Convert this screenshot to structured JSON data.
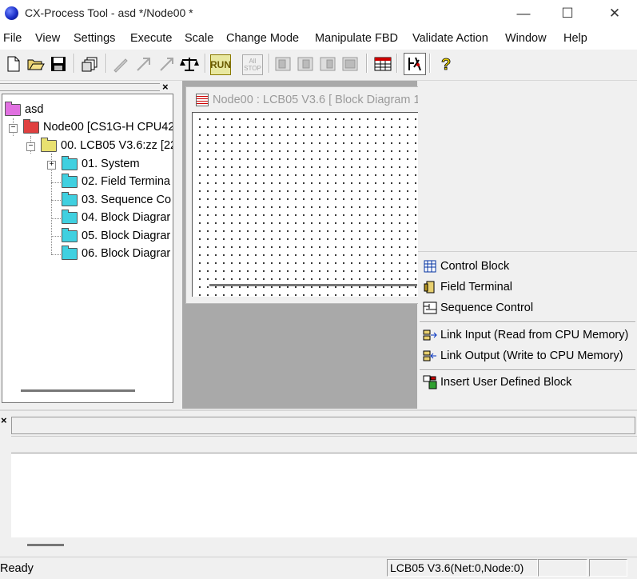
{
  "window": {
    "title": "CX-Process Tool - asd */Node00 *",
    "minimize_glyph": "—",
    "maximize_glyph": "☐",
    "close_glyph": "✕"
  },
  "menu": [
    "File",
    "View",
    "Settings",
    "Execute",
    "Scale",
    "Change Mode",
    "Manipulate FBD",
    "Validate Action",
    "Window",
    "Help"
  ],
  "toolbar": {
    "buttons": [
      {
        "name": "new-icon"
      },
      {
        "name": "open-icon"
      },
      {
        "name": "save-icon"
      },
      {
        "name": "copy-windows-icon"
      },
      {
        "name": "pen-icon"
      },
      {
        "name": "arrow-diagonal-icon"
      },
      {
        "name": "arrow-diagonal-2-icon"
      },
      {
        "name": "balance-icon"
      },
      {
        "name": "run-icon",
        "label": "RUN"
      },
      {
        "name": "all-stop-icon",
        "label": "All STOP"
      },
      {
        "name": "block-1-icon"
      },
      {
        "name": "block-2-icon"
      },
      {
        "name": "block-3-icon"
      },
      {
        "name": "block-4-icon"
      },
      {
        "name": "table-icon"
      },
      {
        "name": "tools-icon"
      },
      {
        "name": "help-icon"
      }
    ]
  },
  "tree": {
    "close_glyph": "×",
    "items": [
      {
        "label": "asd",
        "color": "#e070e0"
      },
      {
        "label": "Node00 [CS1G-H CPU42",
        "color": "#e04040"
      },
      {
        "label": "00. LCB05 V3.6:zz [22",
        "color": "#e8e070"
      },
      {
        "label": "01. System",
        "color": "#40d0e0"
      },
      {
        "label": "02. Field Termina",
        "color": "#40d0e0"
      },
      {
        "label": "03. Sequence Co",
        "color": "#40d0e0"
      },
      {
        "label": "04. Block Diagrar",
        "color": "#40d0e0"
      },
      {
        "label": "05. Block Diagrar",
        "color": "#40d0e0"
      },
      {
        "label": "06. Block Diagrar",
        "color": "#40d0e0"
      }
    ]
  },
  "child_window": {
    "title": "Node00 : LCB05 V3.6 [ Block Diagram 1"
  },
  "context_menu": {
    "items": [
      {
        "label": "Control Block",
        "icon": "control-block-icon"
      },
      {
        "label": "Field Terminal",
        "icon": "field-terminal-icon"
      },
      {
        "label": "Sequence Control",
        "icon": "sequence-control-icon"
      },
      {
        "label": "Link Input (Read from CPU Memory)",
        "icon": "link-input-icon"
      },
      {
        "label": "Link Output (Write to CPU Memory)",
        "icon": "link-output-icon"
      },
      {
        "label": "Insert User Defined Block",
        "icon": "user-block-icon"
      }
    ]
  },
  "bottom_pane": {
    "close_glyph": "×"
  },
  "status": {
    "ready": "Ready",
    "lcb": "LCB05 V3.6(Net:0,Node:0)"
  }
}
